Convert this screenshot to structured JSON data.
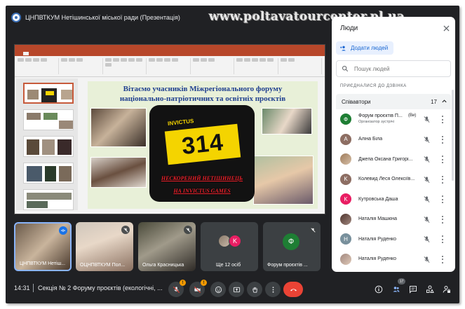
{
  "header": {
    "meeting_title": "ЦНПВТКУМ Нетішинської міської ради (Презентація)",
    "watermark": "www.poltavatourcenter.pl.ua"
  },
  "presentation": {
    "slide_title_line1": "Вітаємо учасників Міжрегіонального форуму",
    "slide_title_line2": "національно-патріотичних та освітніх проєктів",
    "bib_number": "314",
    "bib_top_text": "INVICTUS",
    "caption_line1": "НЕСКОРЕНИЙ НЕТІШИНЕЦЬ",
    "caption_line2": "НА INVICTUS GAMES"
  },
  "tiles": [
    {
      "name": "ЦНПВТКУМ Нетіш..."
    },
    {
      "name": "ОЦНПВТКУМ Пол..."
    },
    {
      "name": "Ольга Красницька"
    },
    {
      "name": "Ще 12 осіб",
      "avatar_letter": "K"
    },
    {
      "name": "Форум проєктів ...",
      "avatar_letter": "Ф"
    }
  ],
  "bottom_bar": {
    "time": "14:31",
    "meeting_name": "Секція № 2 Форуму проєктів (екологічні, ...",
    "warning_badge": "!",
    "participants_count": "17"
  },
  "people_panel": {
    "title": "Люди",
    "add_people_label": "Додати людей",
    "search_placeholder": "Пошук людей",
    "section_label": "ПРИЄДНАЛИСЯ ДО ДЗВІНКА",
    "group_label": "Співавтори",
    "group_count": "17",
    "people": [
      {
        "name": "Форум проєктів П...",
        "you": "(Ви)",
        "sub": "Організатор зустрічі",
        "letter": "Ф",
        "color": "#1e7e34"
      },
      {
        "name": "Аліна Біла",
        "letter": "A",
        "color": "#8d6e63"
      },
      {
        "name": "Джепа Оксана Григорі...",
        "letter": "",
        "color": "#9e7b5a"
      },
      {
        "name": "Колевид Леся Олексіїв...",
        "letter": "K",
        "color": "#8d6e63"
      },
      {
        "name": "Кутровська Даша",
        "letter": "K",
        "color": "#e91e63"
      },
      {
        "name": "Наталія Машкіна",
        "letter": "",
        "color": "#6d4c41"
      },
      {
        "name": "Наталія Руденко",
        "letter": "H",
        "color": "#78909c"
      },
      {
        "name": "Наталія Руденко",
        "letter": "",
        "color": "#a1887f"
      }
    ]
  },
  "colors": {
    "background": "#202124",
    "end_call": "#ea4335",
    "accent": "#1967d2",
    "warning": "#f29900"
  }
}
